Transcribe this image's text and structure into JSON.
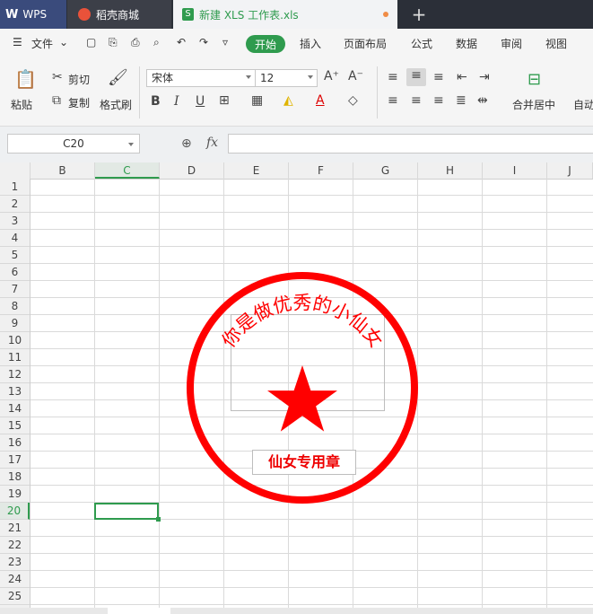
{
  "tabs": [
    {
      "label": "WPS"
    },
    {
      "label": "稻壳商城"
    },
    {
      "label": "新建 XLS 工作表.xls"
    }
  ],
  "menu": {
    "file_label": "文件",
    "items": [
      "开始",
      "插入",
      "页面布局",
      "公式",
      "数据",
      "审阅",
      "视图"
    ],
    "active": "开始"
  },
  "ribbon": {
    "paste": "粘贴",
    "cut": "剪切",
    "copy": "复制",
    "format_painter": "格式刷",
    "font_name": "宋体",
    "font_size": "12",
    "merge_center": "合并居中",
    "wrap": "自动"
  },
  "formula_bar": {
    "name_box": "C20",
    "fx_label": "fx",
    "content": ""
  },
  "grid": {
    "columns": [
      "B",
      "C",
      "D",
      "E",
      "F",
      "G",
      "H",
      "I",
      "J"
    ],
    "rows": [
      "1",
      "2",
      "3",
      "4",
      "5",
      "6",
      "7",
      "8",
      "9",
      "10",
      "11",
      "12",
      "13",
      "14",
      "15",
      "16",
      "17",
      "18",
      "19",
      "20",
      "21",
      "22",
      "23",
      "24",
      "25"
    ],
    "selected_cell": "C20"
  },
  "seal": {
    "arc_text": "你是做优秀的小仙女",
    "label": "仙女专用章",
    "color": "#ff0000"
  },
  "colors": {
    "accent": "#2f9b4e",
    "titlebar": "#2b2f38"
  }
}
